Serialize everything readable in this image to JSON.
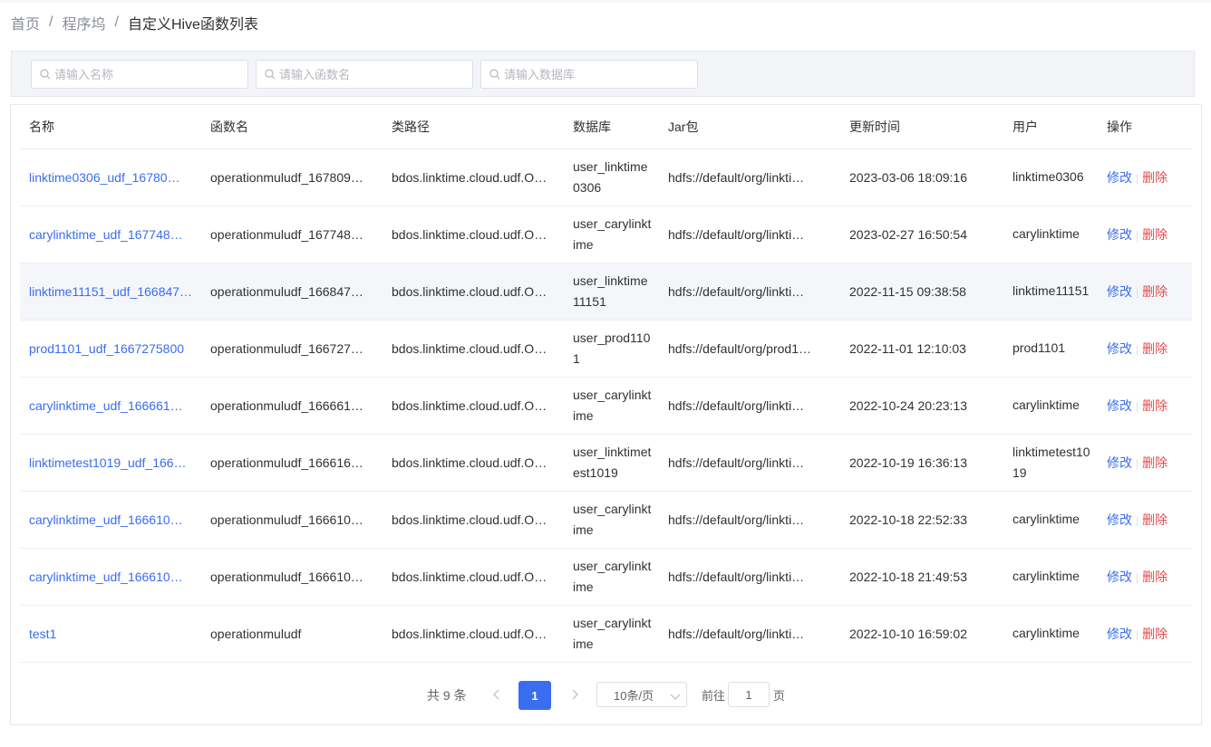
{
  "breadcrumb": {
    "items": [
      "首页",
      "程序坞",
      "自定义Hive函数列表"
    ],
    "separator": "/"
  },
  "filters": {
    "name_placeholder": "请输入名称",
    "func_placeholder": "请输入函数名",
    "db_placeholder": "请输入数据库"
  },
  "table": {
    "headers": {
      "name": "名称",
      "func": "函数名",
      "classpath": "类路径",
      "db": "数据库",
      "jar": "Jar包",
      "time": "更新时间",
      "user": "用户",
      "ops": "操作"
    },
    "edit_label": "修改",
    "delete_label": "删除",
    "rows": [
      {
        "name": "linktime0306_udf_16780…",
        "func": "operationmuludf_167809…",
        "classpath": "bdos.linktime.cloud.udf.O…",
        "db": "user_linktime0306",
        "jar": "hdfs://default/org/linkti…",
        "time": "2023-03-06 18:09:16",
        "user": "linktime0306"
      },
      {
        "name": "carylinktime_udf_167748…",
        "func": "operationmuludf_167748…",
        "classpath": "bdos.linktime.cloud.udf.O…",
        "db": "user_carylinktime",
        "jar": "hdfs://default/org/linkti…",
        "time": "2023-02-27 16:50:54",
        "user": "carylinktime"
      },
      {
        "name": "linktime11151_udf_166847…",
        "func": "operationmuludf_166847…",
        "classpath": "bdos.linktime.cloud.udf.O…",
        "db": "user_linktime11151",
        "jar": "hdfs://default/org/linkti…",
        "time": "2022-11-15 09:38:58",
        "user": "linktime11151"
      },
      {
        "name": "prod1101_udf_1667275800",
        "func": "operationmuludf_166727…",
        "classpath": "bdos.linktime.cloud.udf.O…",
        "db": "user_prod1101",
        "jar": "hdfs://default/org/prod1…",
        "time": "2022-11-01 12:10:03",
        "user": "prod1101"
      },
      {
        "name": "carylinktime_udf_166661…",
        "func": "operationmuludf_166661…",
        "classpath": "bdos.linktime.cloud.udf.O…",
        "db": "user_carylinktime",
        "jar": "hdfs://default/org/linkti…",
        "time": "2022-10-24 20:23:13",
        "user": "carylinktime"
      },
      {
        "name": "linktimetest1019_udf_166…",
        "func": "operationmuludf_166616…",
        "classpath": "bdos.linktime.cloud.udf.O…",
        "db": "user_linktimetest1019",
        "jar": "hdfs://default/org/linkti…",
        "time": "2022-10-19 16:36:13",
        "user": "linktimetest1019"
      },
      {
        "name": "carylinktime_udf_166610…",
        "func": "operationmuludf_166610…",
        "classpath": "bdos.linktime.cloud.udf.O…",
        "db": "user_carylinktime",
        "jar": "hdfs://default/org/linkti…",
        "time": "2022-10-18 22:52:33",
        "user": "carylinktime"
      },
      {
        "name": "carylinktime_udf_166610…",
        "func": "operationmuludf_166610…",
        "classpath": "bdos.linktime.cloud.udf.O…",
        "db": "user_carylinktime",
        "jar": "hdfs://default/org/linkti…",
        "time": "2022-10-18 21:49:53",
        "user": "carylinktime"
      },
      {
        "name": "test1",
        "func": "operationmuludf",
        "classpath": "bdos.linktime.cloud.udf.O…",
        "db": "user_carylinktime",
        "jar": "hdfs://default/org/linkti…",
        "time": "2022-10-10 16:59:02",
        "user": "carylinktime"
      }
    ],
    "hovered_row": 2
  },
  "pagination": {
    "total_text": "共 9 条",
    "current_page": "1",
    "page_size": "10条/页",
    "goto_label": "前往",
    "goto_value": "1",
    "page_suffix": "页"
  },
  "icons": {
    "search": "search-icon",
    "prev": "chevron-left-icon",
    "next": "chevron-right-icon",
    "dropdown": "chevron-down-icon"
  },
  "colors": {
    "accent": "#3a6df0",
    "danger": "#e84a4a",
    "filter_bg": "#f4f5f8",
    "hover_row": "#f4f6fa"
  }
}
